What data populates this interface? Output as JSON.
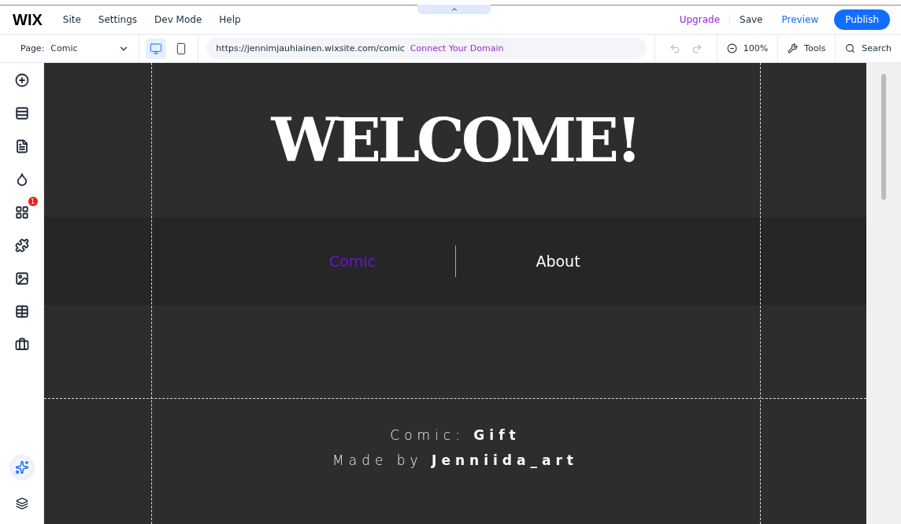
{
  "topbar": {
    "logo": "WIX",
    "menu": [
      "Site",
      "Settings",
      "Dev Mode",
      "Help"
    ],
    "upgrade": "Upgrade",
    "save": "Save",
    "preview": "Preview",
    "publish": "Publish"
  },
  "toolbar": {
    "page_label": "Page:",
    "page_value": "Comic",
    "devices": [
      {
        "kind": "desktop",
        "selected": true
      },
      {
        "kind": "mobile",
        "selected": false
      }
    ],
    "url": "https://jennimjauhiainen.wixsite.com/comic",
    "connect": "Connect Your Domain",
    "zoom": "100%",
    "tools": "Tools",
    "search": "Search"
  },
  "sidebar": {
    "items": [
      {
        "kind": "add"
      },
      {
        "kind": "sections"
      },
      {
        "kind": "pages"
      },
      {
        "kind": "design"
      },
      {
        "kind": "apps",
        "badge": "1"
      },
      {
        "kind": "business"
      },
      {
        "kind": "media"
      },
      {
        "kind": "cms"
      },
      {
        "kind": "portfolio"
      }
    ]
  },
  "canvas": {
    "title": "WELCOME!",
    "nav": [
      {
        "label": "Comic",
        "selected": true
      },
      {
        "label": "About",
        "selected": false
      }
    ],
    "footer": [
      "Comic: **Gift**",
      "Made by **Jenniida_art**"
    ]
  }
}
